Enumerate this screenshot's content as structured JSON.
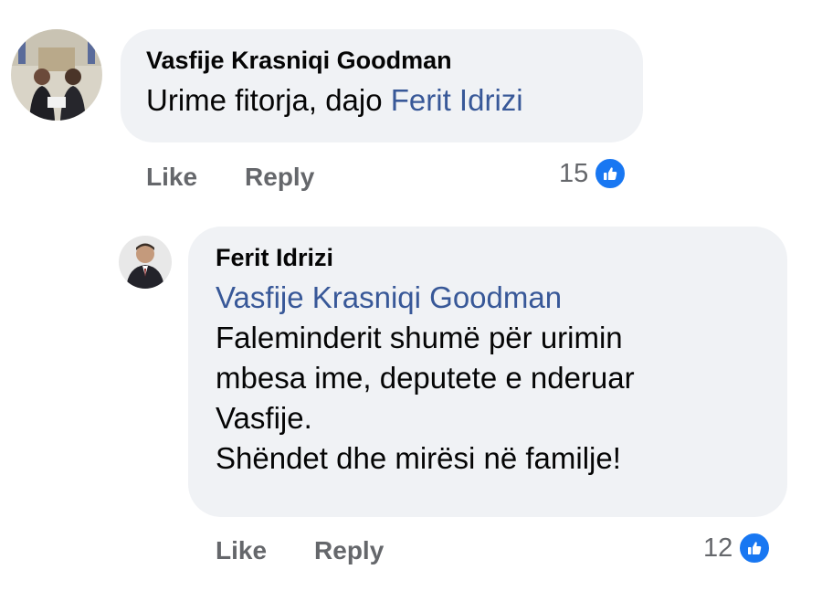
{
  "comments": [
    {
      "author": "Vasfije Krasniqi Goodman",
      "text_before": "Urime fitorja, dajo ",
      "mention": "Ferit Idrizi",
      "like_label": "Like",
      "reply_label": "Reply",
      "reaction_count": "15",
      "reaction_icon": "like-icon"
    }
  ],
  "reply": {
    "author": "Ferit Idrizi",
    "mention": "Vasfije Krasniqi Goodman",
    "lines": [
      "Faleminderit shumë për urimin",
      "mbesa ime, deputete e nderuar",
      "Vasfije.",
      "Shëndet dhe mirësi në familje!"
    ],
    "like_label": "Like",
    "reply_label": "Reply",
    "reaction_count": "12",
    "reaction_icon": "like-icon"
  },
  "colors": {
    "bubble": "#f0f2f5",
    "mention": "#385898",
    "meta": "#65676b",
    "like_badge": "#1877f2"
  }
}
